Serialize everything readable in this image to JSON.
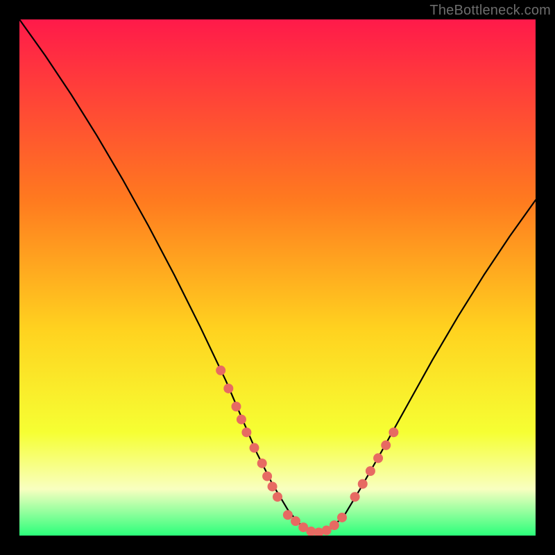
{
  "watermark": "TheBottleneck.com",
  "colors": {
    "gradient_top": "#ff1a4a",
    "gradient_mid1": "#ff7a1f",
    "gradient_mid2": "#ffd21f",
    "gradient_mid3": "#f6ff33",
    "gradient_band_pale": "#f8ffc0",
    "gradient_bottom": "#2bff7a",
    "curve": "#000000",
    "marker": "#e76a62",
    "frame": "#000000"
  },
  "chart_data": {
    "type": "line",
    "title": "",
    "xlabel": "",
    "ylabel": "",
    "xlim": [
      0,
      100
    ],
    "ylim": [
      0,
      100
    ],
    "curve": {
      "x": [
        0,
        5,
        10,
        15,
        20,
        25,
        30,
        35,
        40,
        43,
        46,
        49,
        52,
        54,
        56,
        58,
        60,
        63,
        66,
        70,
        75,
        80,
        85,
        90,
        95,
        100
      ],
      "y": [
        100,
        93,
        85.5,
        77.5,
        69,
        60,
        50.5,
        40.5,
        30,
        23,
        16,
        10,
        5,
        2.5,
        1,
        0.5,
        1,
        4,
        9,
        16,
        25,
        34,
        42.5,
        50.5,
        58,
        65
      ]
    },
    "markers_left": {
      "x": [
        39,
        40.5,
        42,
        43,
        44,
        45.5,
        47,
        48,
        49,
        50
      ],
      "y": [
        32,
        28.5,
        25,
        22.5,
        20,
        17,
        14,
        11.5,
        9.5,
        7.5
      ]
    },
    "markers_bottom": {
      "x": [
        52,
        53.5,
        55,
        56.5,
        58,
        59.5,
        61,
        62.5
      ],
      "y": [
        4,
        2.8,
        1.6,
        0.8,
        0.6,
        1.0,
        2.0,
        3.5
      ]
    },
    "markers_right": {
      "x": [
        65,
        66.5,
        68,
        69.5,
        71,
        72.5
      ],
      "y": [
        7.5,
        10,
        12.5,
        15,
        17.5,
        20
      ]
    }
  }
}
